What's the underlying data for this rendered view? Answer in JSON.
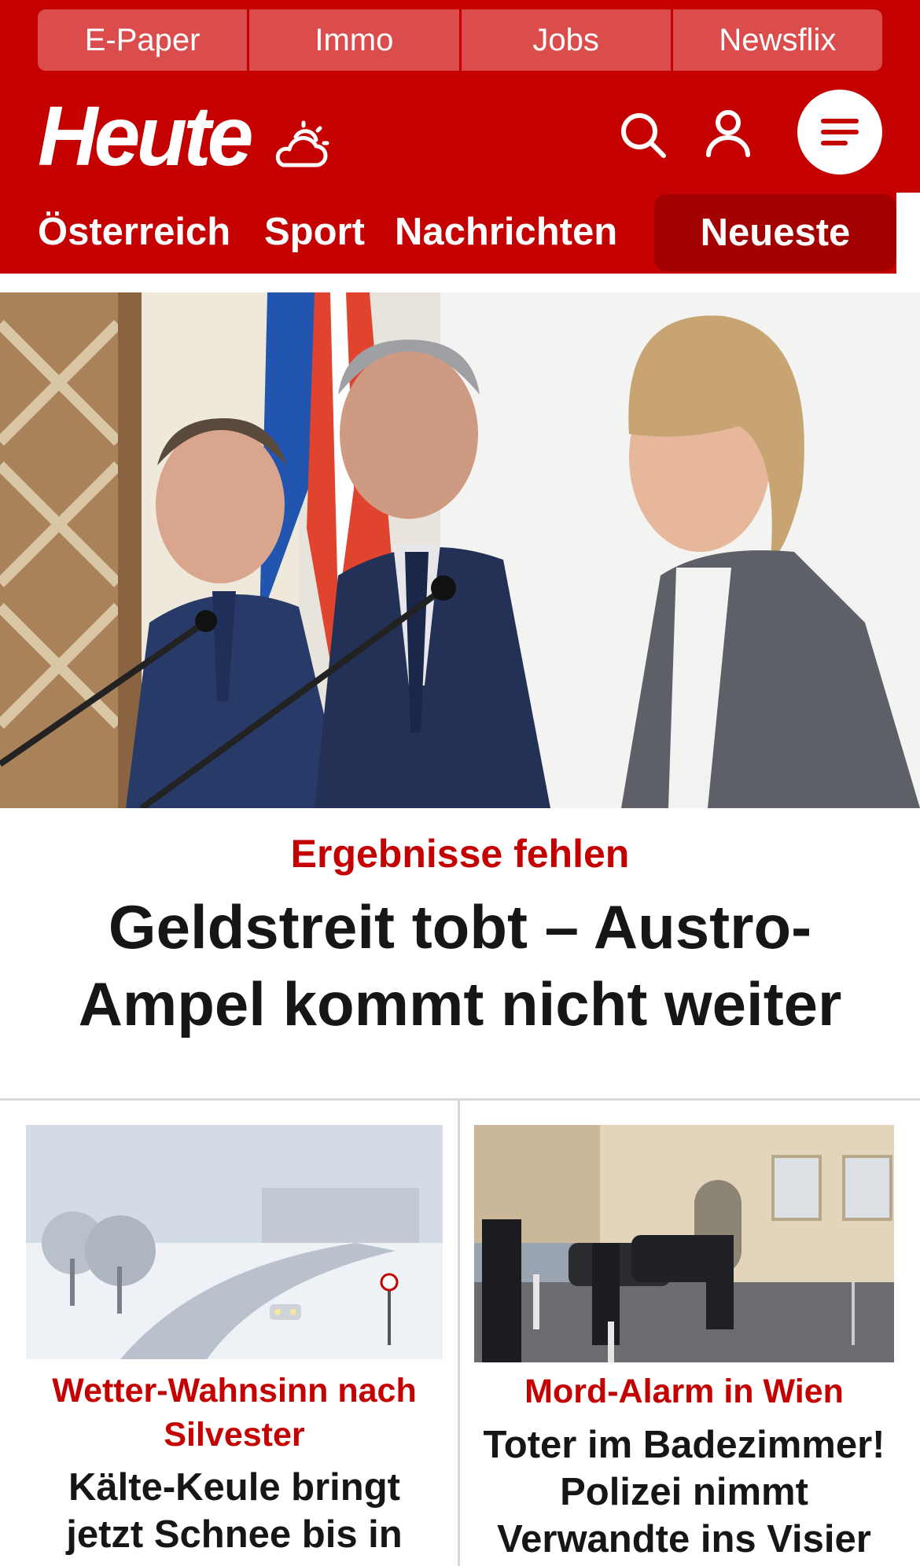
{
  "topnav": [
    "E-Paper",
    "Immo",
    "Jobs",
    "Newsflix"
  ],
  "brand": {
    "logo_text": "Heute",
    "weather_icon": "cloud-sun-icon",
    "search_icon": "search-icon",
    "user_icon": "user-icon",
    "menu_icon": "menu-icon"
  },
  "categories": {
    "items": [
      "Österreich",
      "Sport",
      "Nachrichten"
    ],
    "active": "Neueste"
  },
  "hero": {
    "kicker": "Ergebnisse fehlen",
    "title": "Geldstreit tobt – Austro-Ampel kommt nicht weiter"
  },
  "teasers": [
    {
      "kicker": "Wetter-Wahnsinn nach Silvester",
      "title": "Kälte-Keule bringt jetzt Schnee bis in"
    },
    {
      "kicker": "Mord-Alarm in Wien",
      "title": "Toter im Badezimmer! Polizei nimmt Verwandte ins Visier"
    }
  ],
  "colors": {
    "brand_red": "#c40000",
    "active_tab": "#a30000",
    "topnav_tab": "#db4d4d",
    "title_text": "#161616"
  }
}
